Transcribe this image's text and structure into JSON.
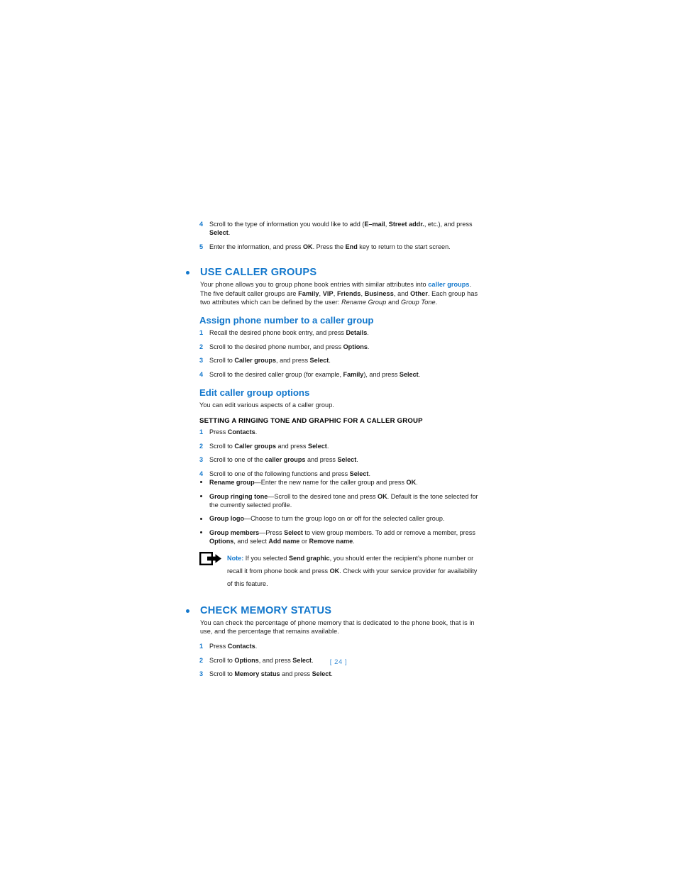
{
  "page": {
    "footer": "[ 24 ]",
    "accent_blue": "#1277cc",
    "body_black": "#1a1a1a"
  },
  "intro_steps": [
    {
      "num": "4",
      "parts": [
        {
          "t": "Scroll to the type of information you would like to add (",
          "s": "normal"
        },
        {
          "t": "E–mail",
          "s": "bold"
        },
        {
          "t": ", ",
          "s": "normal"
        },
        {
          "t": "Street addr.",
          "s": "bold"
        },
        {
          "t": ", etc.), and press ",
          "s": "normal"
        },
        {
          "t": "Select",
          "s": "bold"
        },
        {
          "t": ".",
          "s": "normal"
        }
      ]
    },
    {
      "num": "5",
      "parts": [
        {
          "t": "Enter the information, and press ",
          "s": "normal"
        },
        {
          "t": "OK",
          "s": "bold"
        },
        {
          "t": ". Press the ",
          "s": "normal"
        },
        {
          "t": "End",
          "s": "bold"
        },
        {
          "t": " key to return to the start screen.",
          "s": "normal"
        }
      ]
    }
  ],
  "section_caller_groups": {
    "title": "USE CALLER GROUPS",
    "intro_parts": [
      {
        "t": "Your phone allows you to group phone book entries with similar attributes into ",
        "s": "normal"
      },
      {
        "t": "caller groups",
        "s": "blue"
      },
      {
        "t": ". The five default caller groups are ",
        "s": "normal"
      },
      {
        "t": "Family",
        "s": "bold"
      },
      {
        "t": ", ",
        "s": "normal"
      },
      {
        "t": "VIP",
        "s": "bold"
      },
      {
        "t": ", ",
        "s": "normal"
      },
      {
        "t": "Friends",
        "s": "bold"
      },
      {
        "t": ", ",
        "s": "normal"
      },
      {
        "t": "Business",
        "s": "bold"
      },
      {
        "t": ", and ",
        "s": "normal"
      },
      {
        "t": "Other",
        "s": "bold"
      },
      {
        "t": ". Each group has two attributes which can be defined by the user: ",
        "s": "normal"
      },
      {
        "t": "Rename Group",
        "s": "italic"
      },
      {
        "t": " and ",
        "s": "normal"
      },
      {
        "t": "Group Tone",
        "s": "italic"
      },
      {
        "t": ".",
        "s": "normal"
      }
    ],
    "assign": {
      "heading": "Assign phone number to a caller group",
      "steps": [
        {
          "num": "1",
          "parts": [
            {
              "t": "Recall the desired phone book entry, and press ",
              "s": "normal"
            },
            {
              "t": "Details",
              "s": "bold"
            },
            {
              "t": ".",
              "s": "normal"
            }
          ]
        },
        {
          "num": "2",
          "parts": [
            {
              "t": "Scroll to the desired phone number, and press ",
              "s": "normal"
            },
            {
              "t": "Options",
              "s": "bold"
            },
            {
              "t": ".",
              "s": "normal"
            }
          ]
        },
        {
          "num": "3",
          "parts": [
            {
              "t": "Scroll to ",
              "s": "normal"
            },
            {
              "t": "Caller groups",
              "s": "bold"
            },
            {
              "t": ", and press ",
              "s": "normal"
            },
            {
              "t": "Select",
              "s": "bold"
            },
            {
              "t": ".",
              "s": "normal"
            }
          ]
        },
        {
          "num": "4",
          "parts": [
            {
              "t": "Scroll to the desired caller group (for example, ",
              "s": "normal"
            },
            {
              "t": "Family",
              "s": "bold"
            },
            {
              "t": "), and press ",
              "s": "normal"
            },
            {
              "t": "Select",
              "s": "bold"
            },
            {
              "t": ".",
              "s": "normal"
            }
          ]
        }
      ]
    },
    "edit": {
      "heading": "Edit caller group options",
      "intro": "You can edit various aspects of a caller group.",
      "caps_heading": "SETTING A RINGING TONE AND GRAPHIC FOR A CALLER GROUP",
      "steps": [
        {
          "num": "1",
          "parts": [
            {
              "t": "Press ",
              "s": "normal"
            },
            {
              "t": "Contacts",
              "s": "bold"
            },
            {
              "t": ".",
              "s": "normal"
            }
          ]
        },
        {
          "num": "2",
          "parts": [
            {
              "t": "Scroll to ",
              "s": "normal"
            },
            {
              "t": "Caller groups",
              "s": "bold"
            },
            {
              "t": " and press ",
              "s": "normal"
            },
            {
              "t": "Select",
              "s": "bold"
            },
            {
              "t": ".",
              "s": "normal"
            }
          ]
        },
        {
          "num": "3",
          "parts": [
            {
              "t": "Scroll to one of the ",
              "s": "normal"
            },
            {
              "t": "caller groups",
              "s": "bold"
            },
            {
              "t": " and press ",
              "s": "normal"
            },
            {
              "t": "Select",
              "s": "bold"
            },
            {
              "t": ".",
              "s": "normal"
            }
          ]
        },
        {
          "num": "4",
          "parts": [
            {
              "t": "Scroll to one of the following functions and press ",
              "s": "normal"
            },
            {
              "t": "Select",
              "s": "bold"
            },
            {
              "t": ".",
              "s": "normal"
            }
          ]
        }
      ],
      "functions": [
        {
          "parts": [
            {
              "t": "Rename group",
              "s": "bold"
            },
            {
              "t": "—Enter the new name for the caller group and press ",
              "s": "normal"
            },
            {
              "t": "OK",
              "s": "bold"
            },
            {
              "t": ".",
              "s": "normal"
            }
          ]
        },
        {
          "parts": [
            {
              "t": "Group ringing tone",
              "s": "bold"
            },
            {
              "t": "—Scroll to the desired tone and press ",
              "s": "normal"
            },
            {
              "t": "OK",
              "s": "bold"
            },
            {
              "t": ". Default is the tone selected for the currently selected profile.",
              "s": "normal"
            }
          ]
        },
        {
          "parts": [
            {
              "t": "Group logo",
              "s": "bold"
            },
            {
              "t": "—Choose to turn the group logo on or off for the selected caller group.",
              "s": "normal"
            }
          ]
        },
        {
          "parts": [
            {
              "t": "Group members",
              "s": "bold"
            },
            {
              "t": "—Press ",
              "s": "normal"
            },
            {
              "t": "Select",
              "s": "bold"
            },
            {
              "t": " to view group members. To add or remove a member, press ",
              "s": "normal"
            },
            {
              "t": "Options",
              "s": "bold"
            },
            {
              "t": ", and select ",
              "s": "normal"
            },
            {
              "t": "Add name",
              "s": "bold"
            },
            {
              "t": " or ",
              "s": "normal"
            },
            {
              "t": "Remove name",
              "s": "bold"
            },
            {
              "t": ".",
              "s": "normal"
            }
          ]
        }
      ],
      "note": {
        "icon": "note-arrow-icon",
        "parts": [
          {
            "t": "Note:",
            "s": "blue"
          },
          {
            "t": " If you selected ",
            "s": "normal"
          },
          {
            "t": "Send graphic",
            "s": "bold"
          },
          {
            "t": ", you should enter the recipient’s phone number or recall it from phone book and press ",
            "s": "normal"
          },
          {
            "t": "OK",
            "s": "bold"
          },
          {
            "t": ". Check with your service provider for availability of this feature.",
            "s": "normal"
          }
        ]
      }
    }
  },
  "section_memory_status": {
    "title": "CHECK MEMORY STATUS",
    "intro": "You can check the percentage of phone memory that is dedicated to the phone book, that is in use, and the percentage that remains available.",
    "steps": [
      {
        "num": "1",
        "parts": [
          {
            "t": "Press ",
            "s": "normal"
          },
          {
            "t": "Contacts",
            "s": "bold"
          },
          {
            "t": ".",
            "s": "normal"
          }
        ]
      },
      {
        "num": "2",
        "parts": [
          {
            "t": "Scroll to ",
            "s": "normal"
          },
          {
            "t": "Options",
            "s": "bold"
          },
          {
            "t": ", and press ",
            "s": "normal"
          },
          {
            "t": "Select",
            "s": "bold"
          },
          {
            "t": ".",
            "s": "normal"
          }
        ]
      },
      {
        "num": "3",
        "parts": [
          {
            "t": "Scroll to ",
            "s": "normal"
          },
          {
            "t": "Memory status",
            "s": "bold"
          },
          {
            "t": " and press ",
            "s": "normal"
          },
          {
            "t": "Select",
            "s": "bold"
          },
          {
            "t": ".",
            "s": "normal"
          }
        ]
      }
    ]
  }
}
